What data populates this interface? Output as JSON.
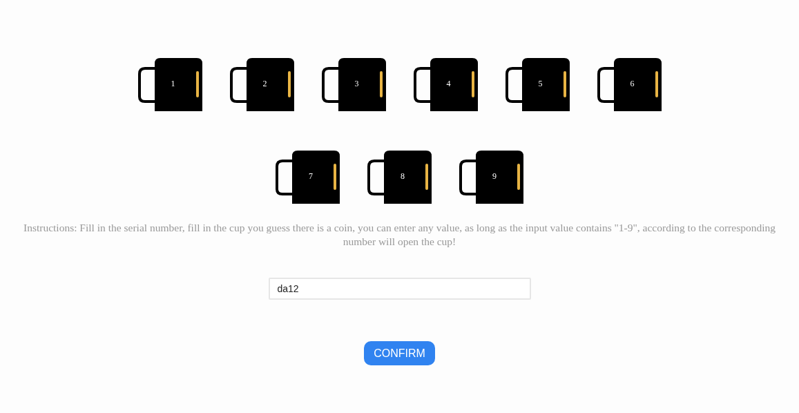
{
  "cups": [
    {
      "number": "1"
    },
    {
      "number": "2"
    },
    {
      "number": "3"
    },
    {
      "number": "4"
    },
    {
      "number": "5"
    },
    {
      "number": "6"
    },
    {
      "number": "7"
    },
    {
      "number": "8"
    },
    {
      "number": "9"
    }
  ],
  "instructions": "Instructions: Fill in the serial number, fill in the cup you guess there is a coin, you can enter any value, as long as the input value contains \"1-9\", according to the corresponding number will open the cup!",
  "input": {
    "value": "da12"
  },
  "button": "CONFIRM"
}
